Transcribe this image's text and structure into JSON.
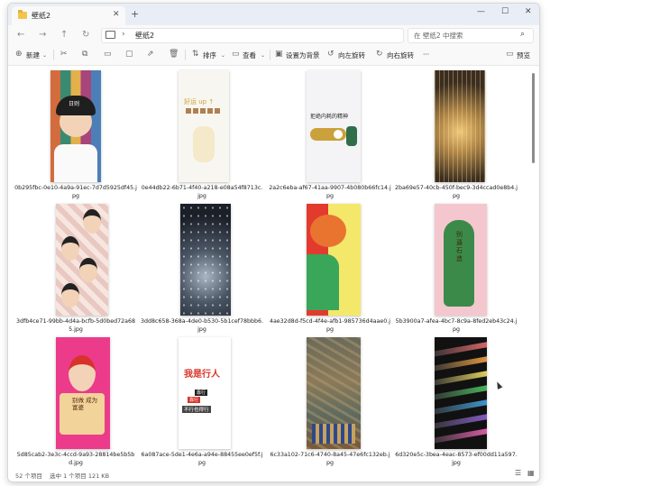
{
  "window": {
    "tab_title": "壁纸2",
    "tab_close": "✕",
    "new_tab": "+",
    "controls": {
      "minimize": "—",
      "maximize": "☐",
      "close": "✕"
    }
  },
  "address": {
    "nav": {
      "back": "←",
      "forward": "→",
      "up": "↑",
      "refresh": "↻"
    },
    "chevron": "›",
    "path": "壁纸2",
    "search_placeholder": "在 壁纸2 中搜索"
  },
  "toolbar": {
    "new": "新建",
    "sort": "排序",
    "view": "查看",
    "set_wallpaper": "设置为背景",
    "rotate_left": "向左旋转",
    "rotate_right": "向右旋转",
    "more": "···",
    "details": "预览"
  },
  "files": [
    {
      "name": "0b295fbc-0e10-4a9a-91ec-7d7d5925df45.jpg"
    },
    {
      "name": "0e44db22-6b71-4f40-a218-e08a54f8713c.jpg"
    },
    {
      "name": "2a2c6eba-af67-41aa-9907-4b080b66fc14.jpg"
    },
    {
      "name": "2ba69e57-40cb-450f-bec9-3d4ccad0e8b4.jpg"
    },
    {
      "name": "3dfb4ce71-99bb-4d4a-bcfb-5d0bed72a685.jpg"
    },
    {
      "name": "3dd8c658-368a-4de0-b530-5b1cef78bbb6.jpg"
    },
    {
      "name": "4ae32d8d-f5cd-4f4e-afb1-985736d4aae0.jpg"
    },
    {
      "name": "5b3900a7-afea-4bc7-8c9a-8fed2eb43c24.jpg"
    },
    {
      "name": "5d85cab2-3e3c-4ccd-9a93-28814be5b5bd.jpg"
    },
    {
      "name": "6a087ace-5de1-4e6a-a94e-88455ee0ef5f.jpg"
    },
    {
      "name": "6c33a102-71c6-4740-8a45-47e6fc132eb.jpg"
    },
    {
      "name": "6d320e5c-3bea-4eac-8573-ef00dd11a597.jpg"
    }
  ],
  "thumb_text": {
    "t1": "日则",
    "t2": "好运 up ↑",
    "t3": "拒绝内耗的精神",
    "t8": "别逼石造",
    "t9": "别做 成为 富婆",
    "t10_title": "我是行人",
    "t10_line1": "靠行",
    "t10_line2": "不行也得行"
  },
  "status": {
    "count": "52 个项目",
    "selection": "选中 1 个项目  121 KB"
  },
  "colors": {
    "accent": "#0067c0",
    "folder": "#f2c44a"
  }
}
